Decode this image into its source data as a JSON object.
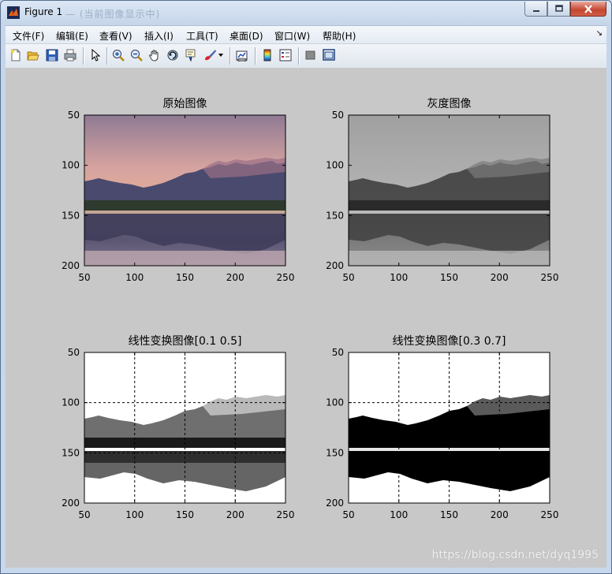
{
  "window": {
    "title": "Figure 1",
    "ghost_title": "— (当前图像显示中)"
  },
  "menus": [
    "文件(F)",
    "编辑(E)",
    "查看(V)",
    "插入(I)",
    "工具(T)",
    "桌面(D)",
    "窗口(W)",
    "帮助(H)"
  ],
  "toolbar": [
    "new-figure-icon",
    "open-icon",
    "save-icon",
    "print-icon",
    "select-arrow-icon",
    "zoom-in-icon",
    "zoom-out-icon",
    "pan-hand-icon",
    "rotate-3d-icon",
    "data-cursor-icon",
    "brush-icon",
    "brush-dropdown-icon",
    "link-plot-icon",
    "colorbar-icon",
    "legend-icon",
    "hide-plot-tools-icon",
    "show-plot-tools-icon"
  ],
  "plots": [
    {
      "title": "原始图像",
      "mode": "color",
      "grid": false
    },
    {
      "title": "灰度图像",
      "mode": "gray",
      "grid": false
    },
    {
      "title": "线性变换图像[0.1 0.5]",
      "mode": "linear1",
      "grid": true
    },
    {
      "title": "线性变换图像[0.3 0.7]",
      "mode": "linear2",
      "grid": true
    }
  ],
  "axes": {
    "x_ticks": [
      "50",
      "100",
      "150",
      "200",
      "250"
    ],
    "y_ticks": [
      "50",
      "100",
      "150",
      "200"
    ]
  },
  "watermark": "https://blog.csdn.net/dyq1995",
  "colors": {
    "figure_bg": "#c8c8c8",
    "close_btn": "#c4452f"
  }
}
